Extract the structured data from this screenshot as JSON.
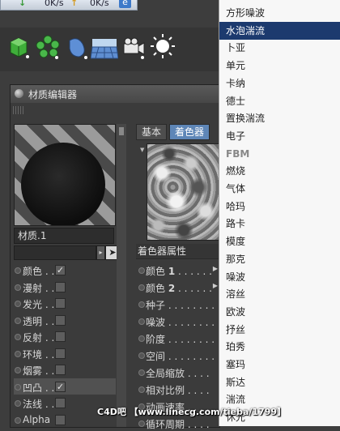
{
  "speedbar": {
    "down_arrow": "↓",
    "down_speed": "0K/s",
    "up_arrow": "↑",
    "up_speed": "0K/s",
    "browser_icon": "e"
  },
  "toolbar": {
    "icons": [
      "cube-icon",
      "cloner-icon",
      "deformer-icon",
      "floor-icon",
      "camera-icon",
      "light-icon"
    ]
  },
  "window": {
    "title": "材质编辑器",
    "material_name": "材质.1",
    "picker_glyph": "➤",
    "drop_glyph": "▸",
    "channels": [
      {
        "label": "颜色 . .",
        "checked": true,
        "active": false
      },
      {
        "label": "漫射 . .",
        "checked": false,
        "active": false
      },
      {
        "label": "发光 . .",
        "checked": false,
        "active": false
      },
      {
        "label": "透明 . .",
        "checked": false,
        "active": false
      },
      {
        "label": "反射 . .",
        "checked": false,
        "active": false
      },
      {
        "label": "环境 . .",
        "checked": false,
        "active": false
      },
      {
        "label": "烟雾 . .",
        "checked": false,
        "active": false
      },
      {
        "label": "凹凸 . .",
        "checked": true,
        "active": true
      },
      {
        "label": "法线 . .",
        "checked": false,
        "active": false
      },
      {
        "label": "Alpha",
        "checked": false,
        "active": false
      }
    ],
    "tabs": {
      "basic": "基本",
      "shader": "着色器"
    },
    "props_header": "着色器属性",
    "props": [
      {
        "label": "颜色 ",
        "num": "1",
        "dots": " . . . . . .",
        "arrow": true
      },
      {
        "label": "颜色 ",
        "num": "2",
        "dots": " . . . . . .",
        "arrow": true
      },
      {
        "label": "种子 . . . . . . . .",
        "num": "",
        "dots": "",
        "arrow": false
      },
      {
        "label": "噪波 . . . . . . . .",
        "num": "",
        "dots": "",
        "arrow": false
      },
      {
        "label": "阶度 . . . . . . . .",
        "num": "",
        "dots": "",
        "arrow": false
      },
      {
        "label": "空间 . . . . . . . .",
        "num": "",
        "dots": "",
        "arrow": false
      },
      {
        "label": "全局缩放 . . . .",
        "num": "",
        "dots": "",
        "arrow": false
      },
      {
        "label": "相对比例 . . . .",
        "num": "",
        "dots": "",
        "arrow": false
      },
      {
        "label": "动画速率 . . . .",
        "num": "",
        "dots": "",
        "arrow": false
      },
      {
        "label": "循环周期 . . . .",
        "num": "",
        "dots": "",
        "arrow": false
      }
    ]
  },
  "menu": {
    "items": [
      {
        "label": "方形噪波",
        "selected": false,
        "bold": false
      },
      {
        "label": "水泡湍流",
        "selected": true,
        "bold": false
      },
      {
        "label": "卜亚",
        "selected": false,
        "bold": false
      },
      {
        "label": "单元",
        "selected": false,
        "bold": false
      },
      {
        "label": "卡纳",
        "selected": false,
        "bold": false
      },
      {
        "label": "德士",
        "selected": false,
        "bold": false
      },
      {
        "label": "置换湍流",
        "selected": false,
        "bold": false
      },
      {
        "label": "电子",
        "selected": false,
        "bold": false
      },
      {
        "label": "FBM",
        "selected": false,
        "bold": true
      },
      {
        "label": "燃烧",
        "selected": false,
        "bold": false
      },
      {
        "label": "气体",
        "selected": false,
        "bold": false
      },
      {
        "label": "哈玛",
        "selected": false,
        "bold": false
      },
      {
        "label": "路卡",
        "selected": false,
        "bold": false
      },
      {
        "label": "模度",
        "selected": false,
        "bold": false
      },
      {
        "label": "那克",
        "selected": false,
        "bold": false
      },
      {
        "label": "噪波",
        "selected": false,
        "bold": false
      },
      {
        "label": "溶丝",
        "selected": false,
        "bold": false
      },
      {
        "label": "欧波",
        "selected": false,
        "bold": false
      },
      {
        "label": "抒丝",
        "selected": false,
        "bold": false
      },
      {
        "label": "珀秀",
        "selected": false,
        "bold": false
      },
      {
        "label": "塞玛",
        "selected": false,
        "bold": false
      },
      {
        "label": "斯达",
        "selected": false,
        "bold": false
      },
      {
        "label": "湍流",
        "selected": false,
        "bold": false
      },
      {
        "label": "休光",
        "selected": false,
        "bold": false
      }
    ]
  },
  "watermark": "C4D吧 【www.linecg.com/tieba/1799】"
}
